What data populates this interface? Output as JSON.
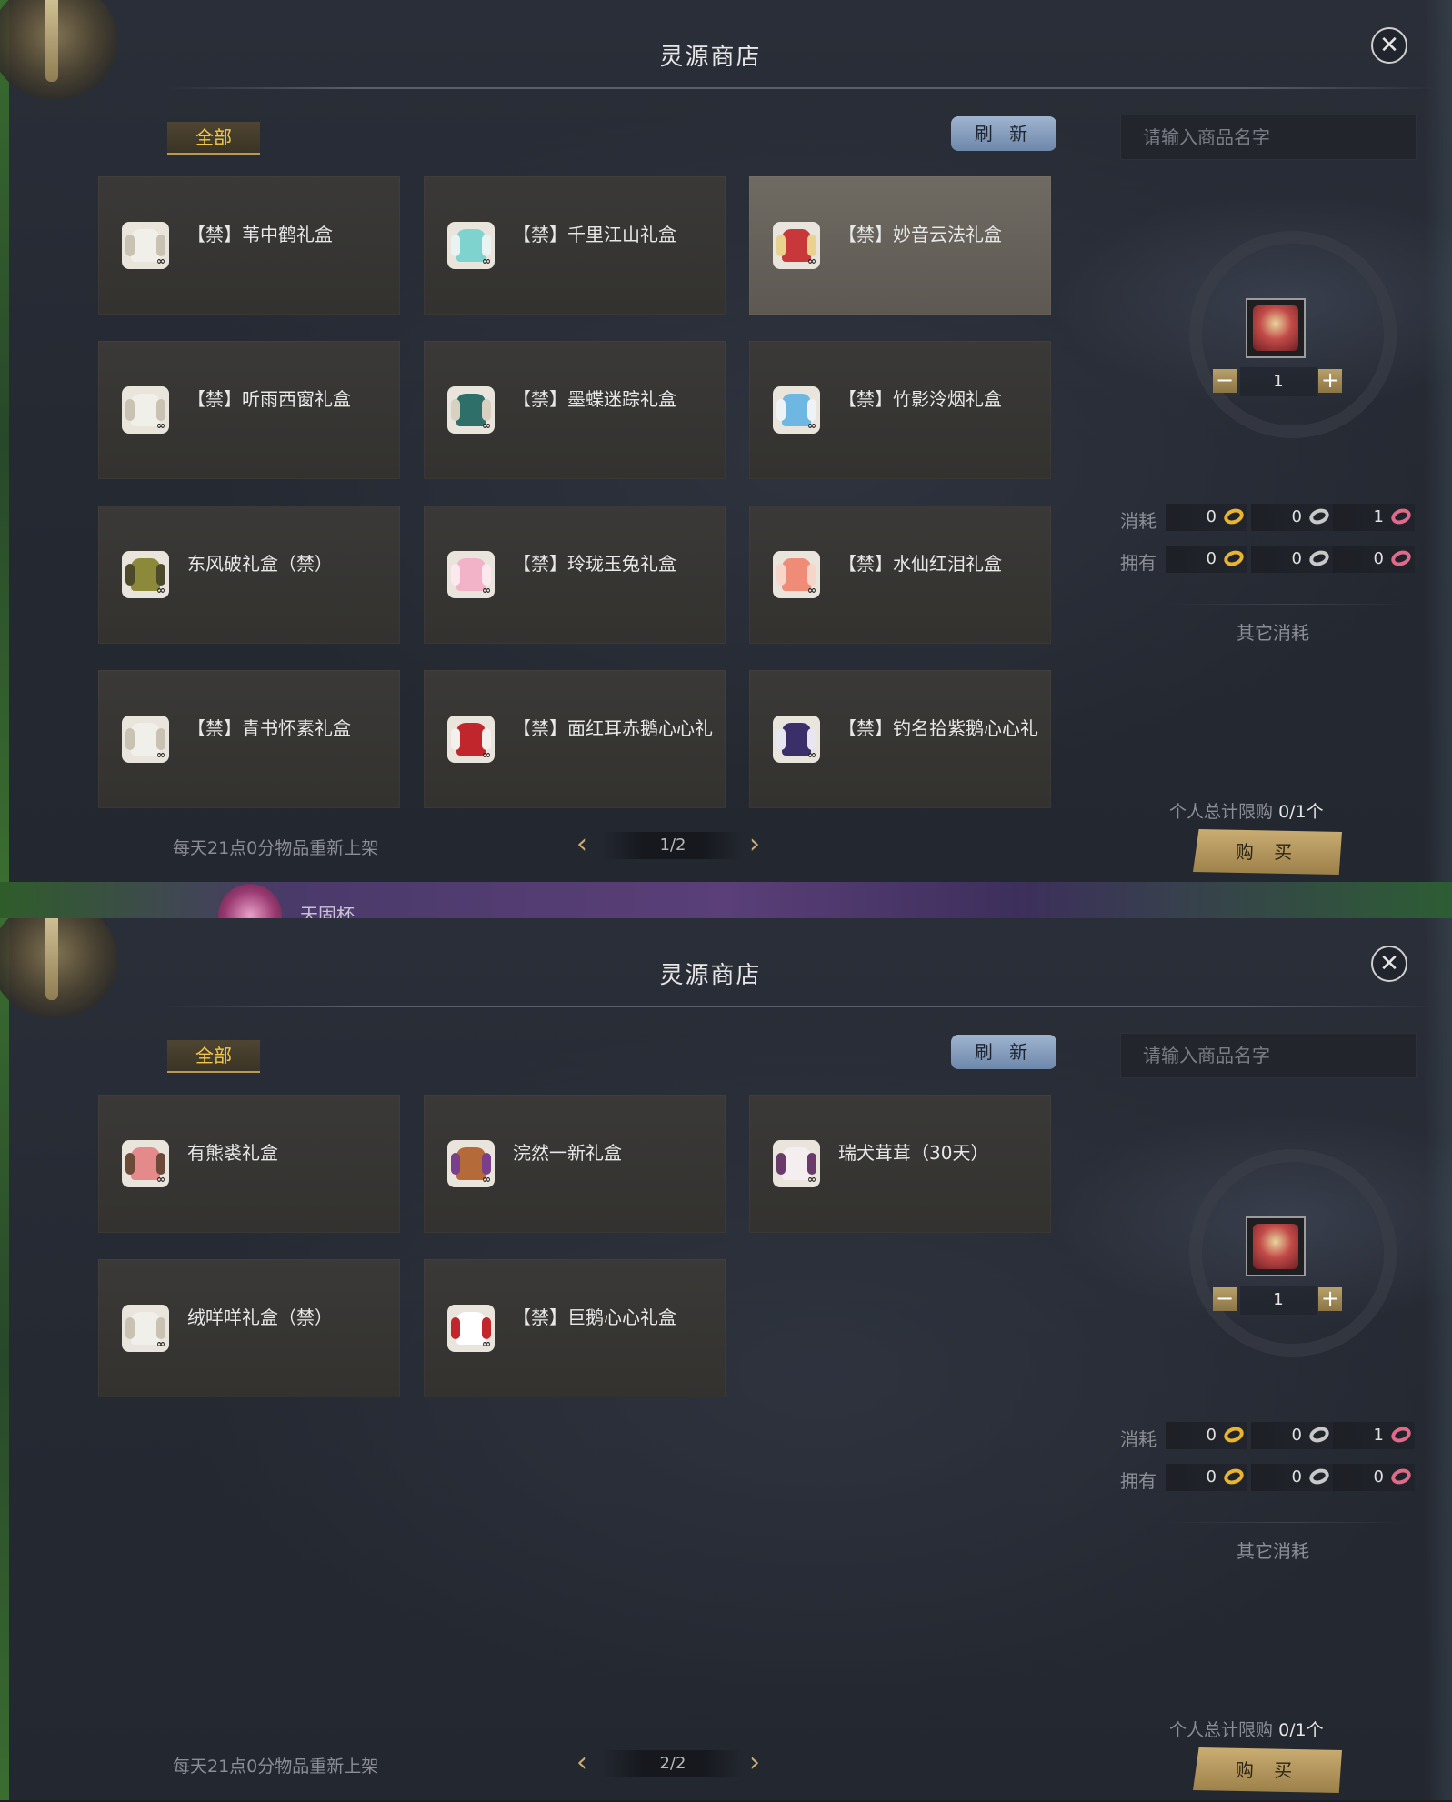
{
  "shop": {
    "title": "灵源商店",
    "tab_all": "全部",
    "refresh": "刷 新",
    "search_placeholder": "请输入商品名字",
    "restock_note": "每天21点0分物品重新上架",
    "other_cost": "其它消耗",
    "limit_label": "个人总计限购",
    "limit_value": "0/1个",
    "buy": "购 买",
    "quantity": "1",
    "cost_label": "消耗",
    "own_label": "拥有",
    "cost": [
      "0",
      "0",
      "1"
    ],
    "own": [
      "0",
      "0",
      "0"
    ]
  },
  "pages": [
    {
      "indicator": "1/2",
      "items": [
        {
          "name": "【禁】苇中鹤礼盒",
          "icon": "white-robe-icon"
        },
        {
          "name": "【禁】千里江山礼盒",
          "icon": "teal-robe-icon"
        },
        {
          "name": "【禁】妙音云法礼盒",
          "icon": "red-robe-icon",
          "selected": true
        },
        {
          "name": "【禁】听雨西窗礼盒",
          "icon": "white-robe-icon"
        },
        {
          "name": "【禁】墨蝶迷踪礼盒",
          "icon": "dark-teal-robe-icon"
        },
        {
          "name": "【禁】竹影泠烟礼盒",
          "icon": "blue-robe-icon"
        },
        {
          "name": "东风破礼盒（禁）",
          "icon": "olive-robe-icon"
        },
        {
          "name": "【禁】玲珑玉兔礼盒",
          "icon": "pink-robe-icon"
        },
        {
          "name": "【禁】水仙红泪礼盒",
          "icon": "salmon-robe-icon"
        },
        {
          "name": "【禁】青书怀素礼盒",
          "icon": "white-robe-icon"
        },
        {
          "name": "【禁】面红耳赤鹅心心礼",
          "icon": "red-white-robe-icon"
        },
        {
          "name": "【禁】钓名拾紫鹅心心礼",
          "icon": "purple-robe-icon"
        }
      ]
    },
    {
      "indicator": "2/2",
      "items": [
        {
          "name": "有熊裘礼盒",
          "icon": "bear-paw-icon"
        },
        {
          "name": "浣然一新礼盒",
          "icon": "bird-mount-icon"
        },
        {
          "name": "瑞犬茸茸（30天）",
          "icon": "puppy-icon"
        },
        {
          "name": "绒咩咩礼盒（禁）",
          "icon": "white-robe-icon"
        },
        {
          "name": "【禁】巨鹅心心礼盒",
          "icon": "goose-icon"
        }
      ]
    }
  ],
  "overlay_fragment": "天固杯",
  "colors": {
    "gold_text": "#f2c94c",
    "card_bg": "#3a3937",
    "card_selected_bg": "#6f6b63",
    "refresh_bg": "#8aa0bf",
    "buy_bg": "#c9ad72"
  }
}
